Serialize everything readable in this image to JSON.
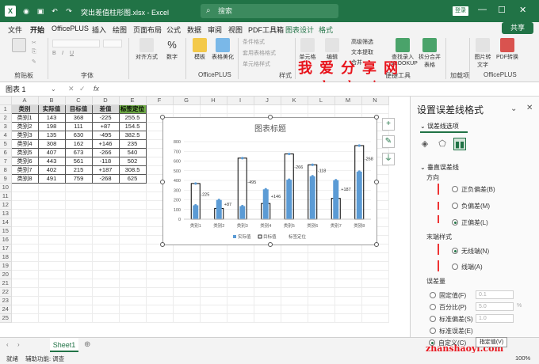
{
  "window": {
    "doc_title": "突出差值柱形图.xlsx - Excel",
    "search_placeholder": "搜索",
    "login": "登录"
  },
  "menu": {
    "tabs": [
      "文件",
      "开始",
      "OfficePLUS",
      "插入",
      "绘图",
      "页面布局",
      "公式",
      "数据",
      "审阅",
      "视图",
      "PDF工具箱",
      "图表设计",
      "格式"
    ],
    "share": "共享"
  },
  "ribbon": {
    "groups": [
      "剪贴板",
      "字体",
      "对齐方式",
      "数字",
      "OfficePLUS",
      "样式",
      "便捷工具",
      "加载项",
      "OfficePLUS"
    ],
    "items": {
      "align": "对齐方式",
      "number": "数字",
      "number_symbol": "%",
      "template": "模板",
      "table_beautify": "表格美化",
      "cond_format": "条件格式",
      "table_format": "套用表格格式",
      "cell_style": "单元格样式",
      "cells": "单元格",
      "edit": "编辑",
      "filter": "高级筛选",
      "text_extract": "文本提取",
      "combine": "合并",
      "vlookup": "查找录入 VLOOKUP",
      "split": "拆分合并表格",
      "img_text": "图片转文字",
      "pdf_convert": "PDF转换"
    }
  },
  "watermark": {
    "top": "我爱分享网",
    "url": "www.zhanshaoyi.com",
    "bottom": "zhanshaoyi.com"
  },
  "formula": {
    "name_box": "图表 1",
    "fx": "fx"
  },
  "grid": {
    "columns": [
      "A",
      "B",
      "C",
      "D",
      "E",
      "F",
      "G",
      "H",
      "I",
      "J",
      "K",
      "L",
      "M",
      "N"
    ],
    "header": [
      "类别",
      "实际值",
      "目标值",
      "差值",
      "标签定位"
    ],
    "rows": [
      [
        "类别1",
        "143",
        "368",
        "-225",
        "255.5"
      ],
      [
        "类别2",
        "198",
        "111",
        "+87",
        "154.5"
      ],
      [
        "类别3",
        "135",
        "630",
        "-495",
        "382.5"
      ],
      [
        "类别4",
        "308",
        "162",
        "+146",
        "235"
      ],
      [
        "类别5",
        "407",
        "673",
        "-266",
        "540"
      ],
      [
        "类别6",
        "443",
        "561",
        "-118",
        "502"
      ],
      [
        "类别7",
        "402",
        "215",
        "+187",
        "308.5"
      ],
      [
        "类别8",
        "491",
        "759",
        "-268",
        "625"
      ]
    ],
    "row_count": 25
  },
  "chart_data": {
    "type": "bar",
    "title": "图表标题",
    "categories": [
      "类别1",
      "类别2",
      "类别3",
      "类别4",
      "类别5",
      "类别6",
      "类别7",
      "类别8"
    ],
    "series": [
      {
        "name": "实际值",
        "values": [
          143,
          198,
          135,
          308,
          407,
          443,
          402,
          491
        ]
      },
      {
        "name": "目标值",
        "values": [
          368,
          111,
          630,
          162,
          673,
          561,
          215,
          759
        ]
      },
      {
        "name": "标签定位",
        "values": [
          255.5,
          154.5,
          382.5,
          235,
          540,
          502,
          308.5,
          625
        ]
      }
    ],
    "diff_labels": [
      "-225",
      "+87",
      "-495",
      "+146",
      "-266",
      "-118",
      "+187",
      "-268"
    ],
    "y_ticks": [
      "0",
      "100",
      "200",
      "300",
      "400",
      "500",
      "600",
      "700",
      "800"
    ],
    "ylim": [
      0,
      800
    ],
    "grid": true,
    "legend": "bottom",
    "colors": {
      "actual": "#5b9bd5",
      "target_border": "#000000",
      "marker": "#5b9bd5"
    }
  },
  "pane": {
    "title": "设置误差线格式",
    "options_tab": "误差线选项",
    "vertical_section": "垂直误差线",
    "direction_label": "方向",
    "directions": [
      "正负偏差(B)",
      "负偏差(M)",
      "正偏差(L)"
    ],
    "direction_selected": 2,
    "end_style_label": "末端样式",
    "end_styles": [
      "无线端(N)",
      "线端(A)"
    ],
    "end_selected": 0,
    "amount_label": "误差量",
    "amounts": [
      "固定值(F)",
      "百分比(P)",
      "标准偏差(S)",
      "标准误差(E)",
      "自定义(C)"
    ],
    "amount_selected": 4,
    "fixed_value": "0.1",
    "percent_value": "5.0",
    "percent_unit": "%",
    "stddev_value": "1.0",
    "custom_btn": "指定值(V)"
  },
  "sheet": {
    "tab": "Sheet1"
  },
  "status": {
    "ready": "就绪",
    "accessibility": "辅助功能: 调查",
    "zoom": "100%"
  }
}
